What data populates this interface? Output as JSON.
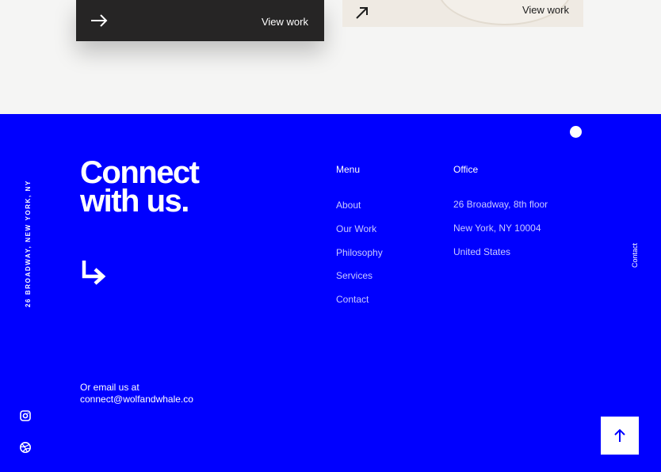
{
  "cards": [
    {
      "label": "View work",
      "theme": "dark"
    },
    {
      "label": "View work",
      "theme": "light"
    }
  ],
  "footer": {
    "headline_line1": "Connect",
    "headline_line2": "with us.",
    "email_lead": "Or email us at",
    "email": "connect@wolfandwhale.co",
    "vertical_address": "26 BROADWAY, NEW YORK, NY",
    "vertical_contact": "Contact",
    "menu": {
      "title": "Menu",
      "items": [
        "About",
        "Our Work",
        "Philosophy",
        "Services",
        "Contact"
      ]
    },
    "office": {
      "title": "Office",
      "lines": [
        "26 Broadway, 8th floor",
        "New York, NY 10004",
        "United States"
      ]
    }
  },
  "colors": {
    "footer_bg": "#0000ff",
    "link": "#c9c9ff",
    "dark_card": "#262525"
  },
  "icons": [
    "arrow-right-icon",
    "arrow-up-right-icon",
    "arrow-down-right-icon",
    "instagram-icon",
    "dribbble-icon",
    "arrow-up-icon"
  ]
}
